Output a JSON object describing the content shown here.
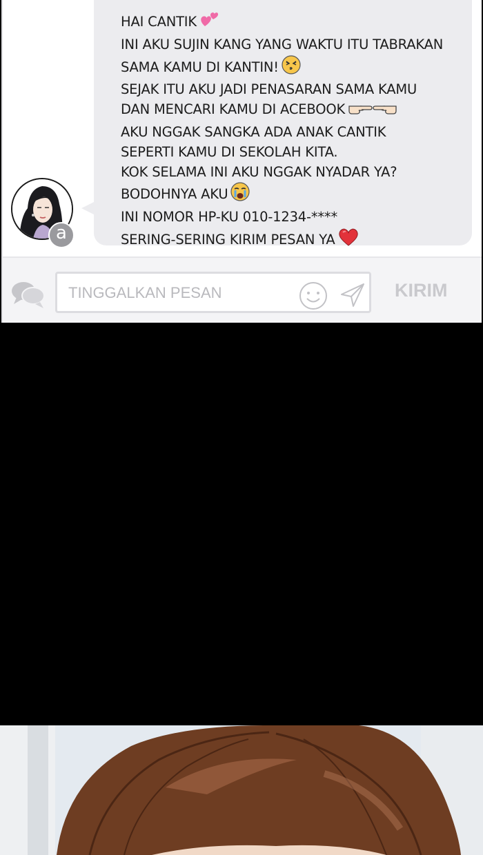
{
  "message": {
    "lines": [
      "HAI CANTIK",
      "INI AKU SUJIN KANG YANG WAKTU ITU TABRAKAN",
      "SAMA KAMU DI KANTIN!",
      "SEJAK ITU AKU JADI PENASARAN SAMA KAMU",
      "DAN MENCARI KAMU DI ACEBOOK",
      "AKU NGGAK SANGKA ADA ANAK CANTIK",
      "SEPERTI KAMU DI SEKOLAH KITA.",
      "KOK SELAMA INI AKU NGGAK NYADAR YA?",
      "BODOHNYA AKU",
      "INI NOMOR HP-KU 010-1234-****",
      "SERING-SERING KIRIM PESAN YA"
    ],
    "emojis": [
      "two-hearts-icon",
      "face-kiss-icon",
      "pointing-hands-icon",
      "crying-face-icon",
      "red-heart-icon"
    ]
  },
  "avatar": {
    "badge_letter": "a"
  },
  "composer": {
    "placeholder": "TINGGALKAN PESAN",
    "send_label": "KIRIM"
  },
  "colors": {
    "bubble": "#ececef",
    "panel": "#f4f4f6",
    "hair": "#6e3d22",
    "send_label": "#c9c9cd"
  }
}
